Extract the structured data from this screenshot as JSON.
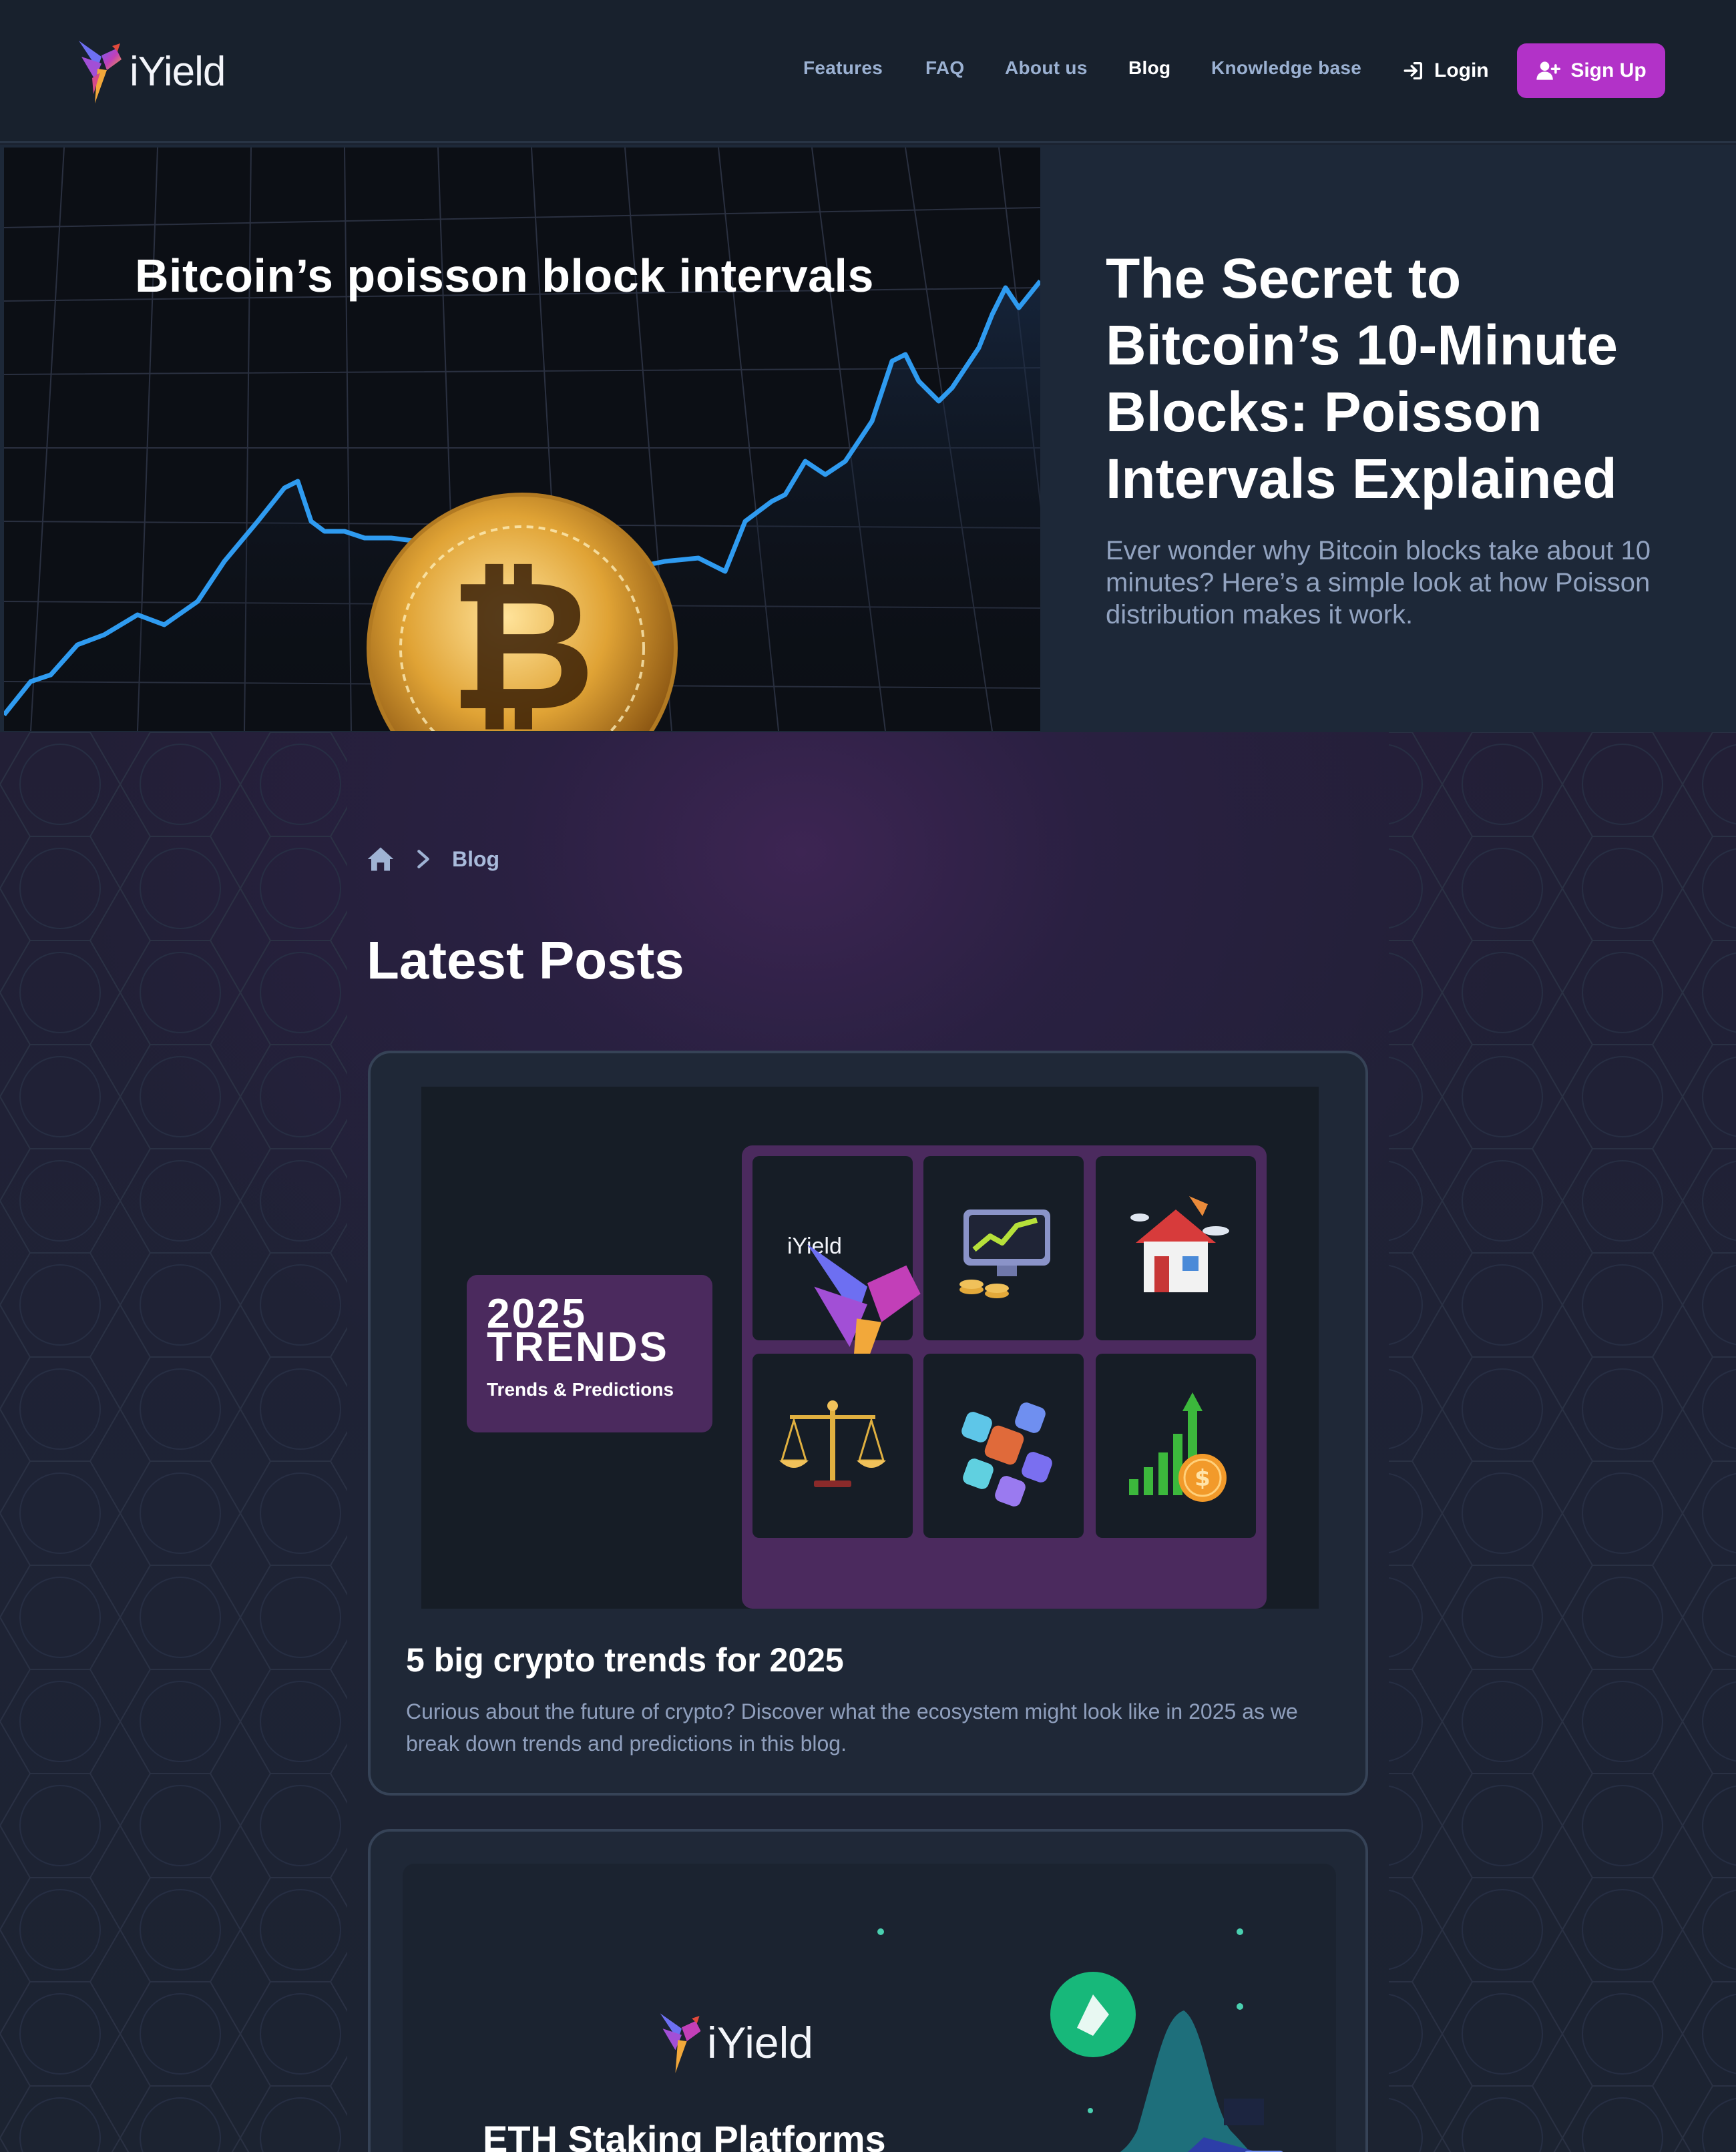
{
  "brand": {
    "name": "iYield",
    "accent": "#b232c8"
  },
  "nav": {
    "links": [
      {
        "label": "Features"
      },
      {
        "label": "FAQ"
      },
      {
        "label": "About us"
      },
      {
        "label": "Blog",
        "active": true
      },
      {
        "label": "Knowledge base"
      }
    ],
    "login_label": "Login",
    "signup_label": "Sign Up"
  },
  "hero": {
    "image_title": "Bitcoin’s poisson block intervals",
    "title": "The Secret to Bitcoin’s 10-Minute Blocks: Poisson Intervals Explained",
    "subtitle": "Ever wonder why Bitcoin blocks take about 10 minutes? Here’s a simple look at how Poisson distribution makes it work."
  },
  "breadcrumb": {
    "current": "Blog"
  },
  "latest": {
    "heading": "Latest Posts",
    "posts": [
      {
        "image": {
          "line1": "2025",
          "line2": "TRENDS",
          "line3": "Trends & Predictions",
          "logo": "iYield"
        },
        "title": "5 big crypto trends for 2025",
        "description": "Curious about the future of crypto? Discover what the ecosystem might look like in 2025 as we break down trends and predictions in this blog."
      },
      {
        "image": {
          "logo": "iYield",
          "title": "ETH Staking Platforms"
        }
      }
    ]
  },
  "icons": [
    "home-icon",
    "chevron-right-icon",
    "login-icon",
    "user-plus-icon",
    "logo-bird-icon"
  ]
}
